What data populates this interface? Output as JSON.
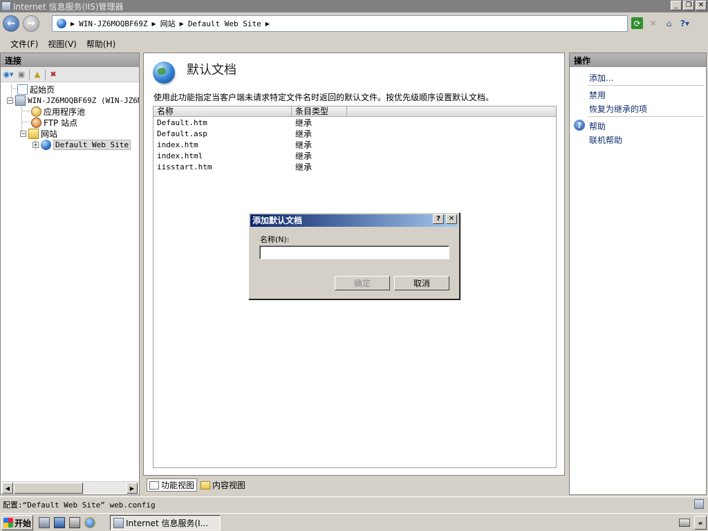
{
  "window": {
    "title": "Internet 信息服务(IIS)管理器",
    "minimize": "_",
    "restore": "❐",
    "close": "✕"
  },
  "address": {
    "crumbs": [
      "WIN-JZ6MOQBF69Z",
      "网站",
      "Default Web Site"
    ],
    "separator": "▶"
  },
  "menu": {
    "file": "文件(F)",
    "view": "视图(V)",
    "help": "帮助(H)"
  },
  "connections": {
    "header": "连接",
    "tree": {
      "start_page": "起始页",
      "server": "WIN-JZ6MOQBF69Z (WIN-JZ6MO",
      "app_pools": "应用程序池",
      "ftp_sites": "FTP 站点",
      "sites": "网站",
      "default_site": "Default Web Site",
      "expander_minus": "−",
      "expander_plus": "+"
    }
  },
  "feature": {
    "title": "默认文档",
    "description": "使用此功能指定当客户端未请求特定文件名时返回的默认文件。按优先级顺序设置默认文档。",
    "columns": {
      "name": "名称",
      "type": "条目类型"
    },
    "rows": [
      {
        "name": "Default.htm",
        "type": "继承"
      },
      {
        "name": "Default.asp",
        "type": "继承"
      },
      {
        "name": "index.htm",
        "type": "继承"
      },
      {
        "name": "index.html",
        "type": "继承"
      },
      {
        "name": "iisstart.htm",
        "type": "继承"
      }
    ]
  },
  "view_tabs": {
    "features": "功能视图",
    "content": "内容视图"
  },
  "dialog": {
    "title": "添加默认文档",
    "help": "?",
    "close": "✕",
    "name_label": "名称(N):",
    "name_value": "",
    "ok": "确定",
    "cancel": "取消"
  },
  "actions": {
    "header": "操作",
    "add": "添加...",
    "disable": "禁用",
    "revert": "恢复为继承的项",
    "help": "帮助",
    "online_help": "联机帮助",
    "help_glyph": "?"
  },
  "status": {
    "text": "配置:“Default Web Site” web.config"
  },
  "taskbar": {
    "start": "开始",
    "task": "Internet 信息服务(I...",
    "tray_expand": "«"
  }
}
